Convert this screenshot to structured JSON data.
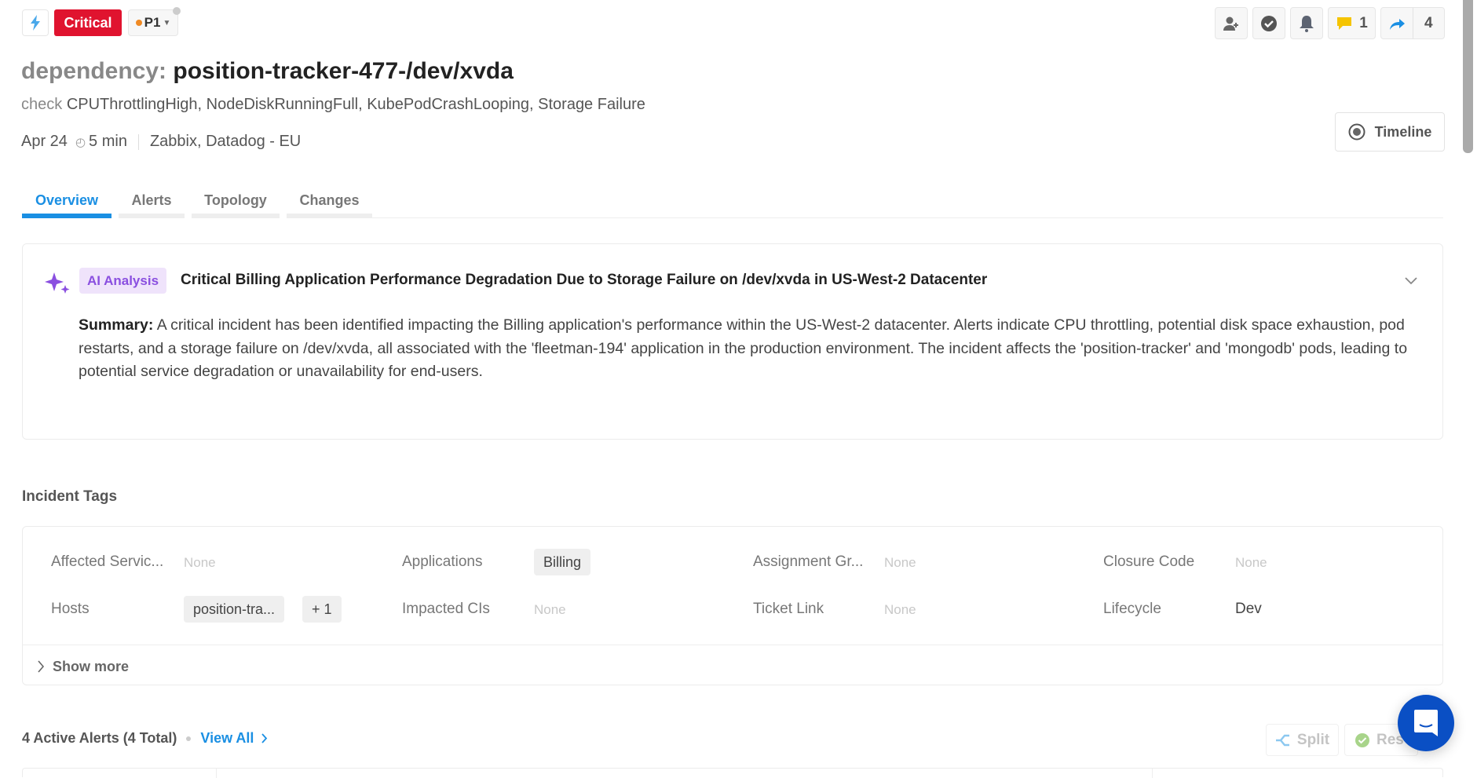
{
  "header": {
    "severity": "Critical",
    "priority": "P1",
    "title_prefix": "dependency:",
    "title": "position-tracker-477-/dev/xvda",
    "check_prefix": "check",
    "checks": "CPUThrottlingHigh, NodeDiskRunningFull, KubePodCrashLooping, Storage Failure",
    "date": "Apr 24",
    "duration": "5 min",
    "sources": "Zabbix, Datadog - EU",
    "comments_count": "1",
    "shares_count": "4",
    "timeline_label": "Timeline"
  },
  "colors": {
    "critical": "#e0132f",
    "accent": "#1a8fe3",
    "ai": "#8a4fe0",
    "priority_dot": "#f08a24"
  },
  "tabs": [
    {
      "label": "Overview",
      "active": true
    },
    {
      "label": "Alerts"
    },
    {
      "label": "Topology"
    },
    {
      "label": "Changes"
    }
  ],
  "ai": {
    "badge": "AI Analysis",
    "title": "Critical Billing Application Performance Degradation Due to Storage Failure on /dev/xvda in US-West-2 Datacenter",
    "summary_label": "Summary:",
    "summary": "A critical incident has been identified impacting the Billing application's performance within the US-West-2 datacenter. Alerts indicate CPU throttling, potential disk space exhaustion, pod restarts, and a storage failure on /dev/xvda, all associated with the 'fleetman-194' application in the production environment. The incident affects the 'position-tracker' and 'mongodb' pods, leading to potential service degradation or unavailability for end-users."
  },
  "tags": {
    "heading": "Incident Tags",
    "affected_services": "Affected Servic...",
    "applications": "Applications",
    "applications_value": "Billing",
    "assignment_group": "Assignment Gr...",
    "closure_code": "Closure Code",
    "hosts": "Hosts",
    "hosts_value": "position-tra...",
    "hosts_more": "+ 1",
    "impacted_cis": "Impacted CIs",
    "ticket_link": "Ticket Link",
    "lifecycle": "Lifecycle",
    "lifecycle_value": "Dev",
    "none": "None",
    "show_more": "Show more"
  },
  "alerts": {
    "heading": "4 Active Alerts (4 Total)",
    "view_all": "View All",
    "split": "Split",
    "resolve": "Res"
  }
}
